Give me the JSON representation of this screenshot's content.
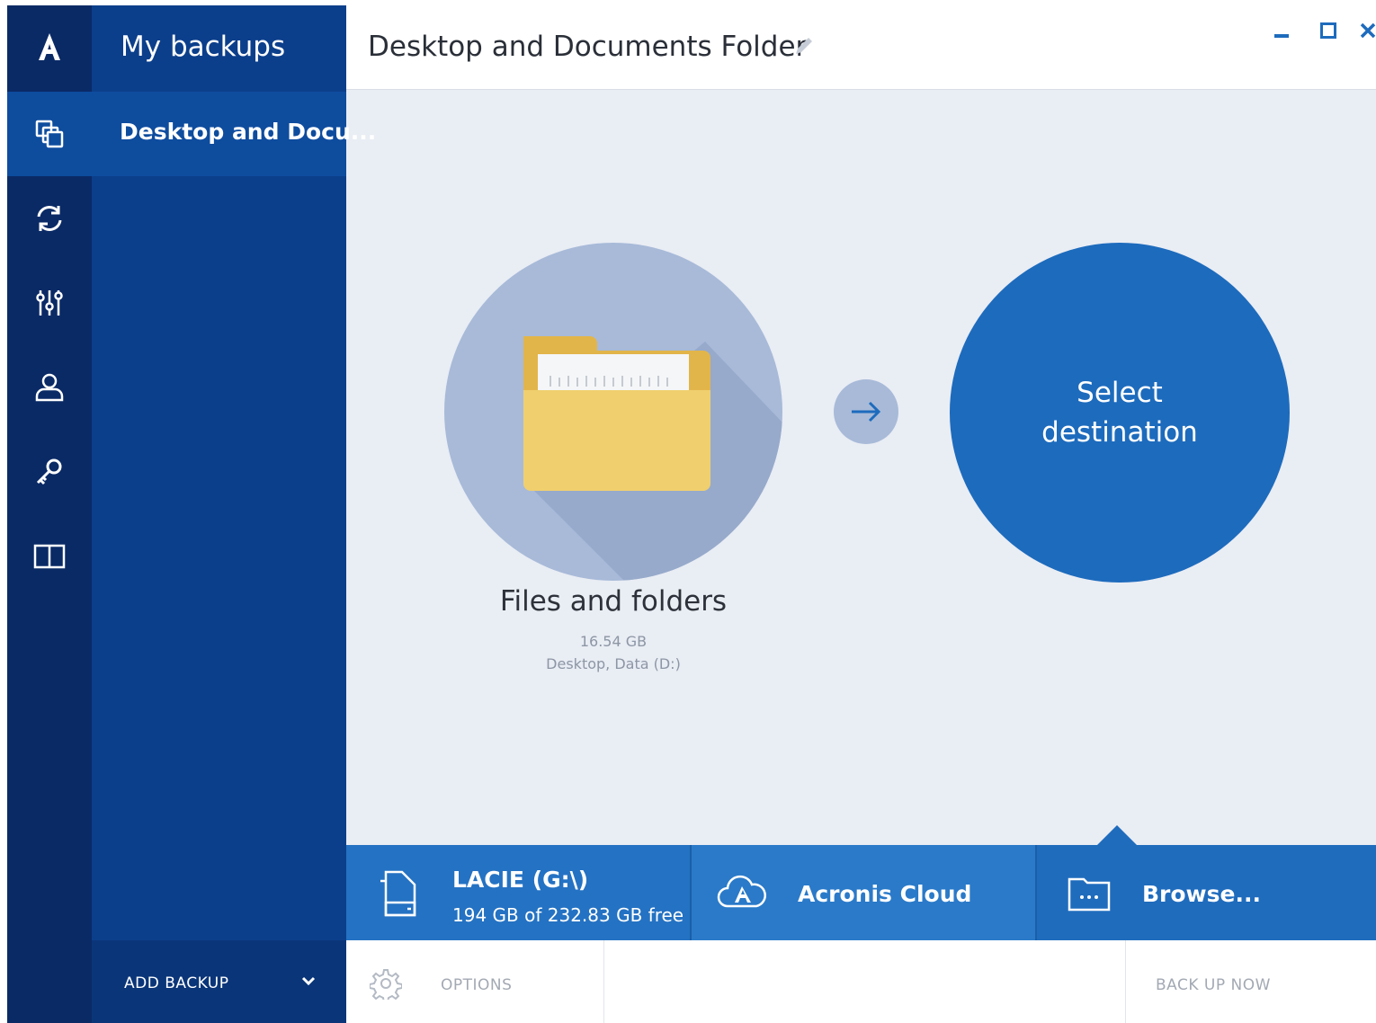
{
  "rail": {
    "items": [
      {
        "icon": "acronis-logo-icon"
      },
      {
        "icon": "backup-copies-icon",
        "active": true
      },
      {
        "icon": "sync-icon"
      },
      {
        "icon": "tools-sliders-icon"
      },
      {
        "icon": "account-icon"
      },
      {
        "icon": "key-icon"
      },
      {
        "icon": "book-icon"
      }
    ]
  },
  "side": {
    "title": "My backups",
    "items": [
      {
        "label": "Desktop and Docu..."
      }
    ],
    "add_backup_label": "ADD BACKUP"
  },
  "header": {
    "title": "Desktop and Documents Folder"
  },
  "source": {
    "title": "Files and folders",
    "size": "16.54 GB",
    "location": "Desktop, Data (D:)"
  },
  "destination": {
    "label": "Select destination"
  },
  "destinations": [
    {
      "name": "LACIE (G:\\)",
      "sub": "194 GB of 232.83 GB free",
      "icon": "external-drive-icon"
    },
    {
      "name": "Acronis Cloud",
      "icon": "cloud-icon"
    },
    {
      "name": "Browse...",
      "icon": "folder-browse-icon"
    }
  ],
  "bottom": {
    "options_label": "OPTIONS",
    "backup_now_label": "BACK UP NOW"
  },
  "colors": {
    "rail": "#0a2a66",
    "side": "#0c3f8b",
    "accent": "#1d6bbd",
    "background": "#e9edf4"
  }
}
